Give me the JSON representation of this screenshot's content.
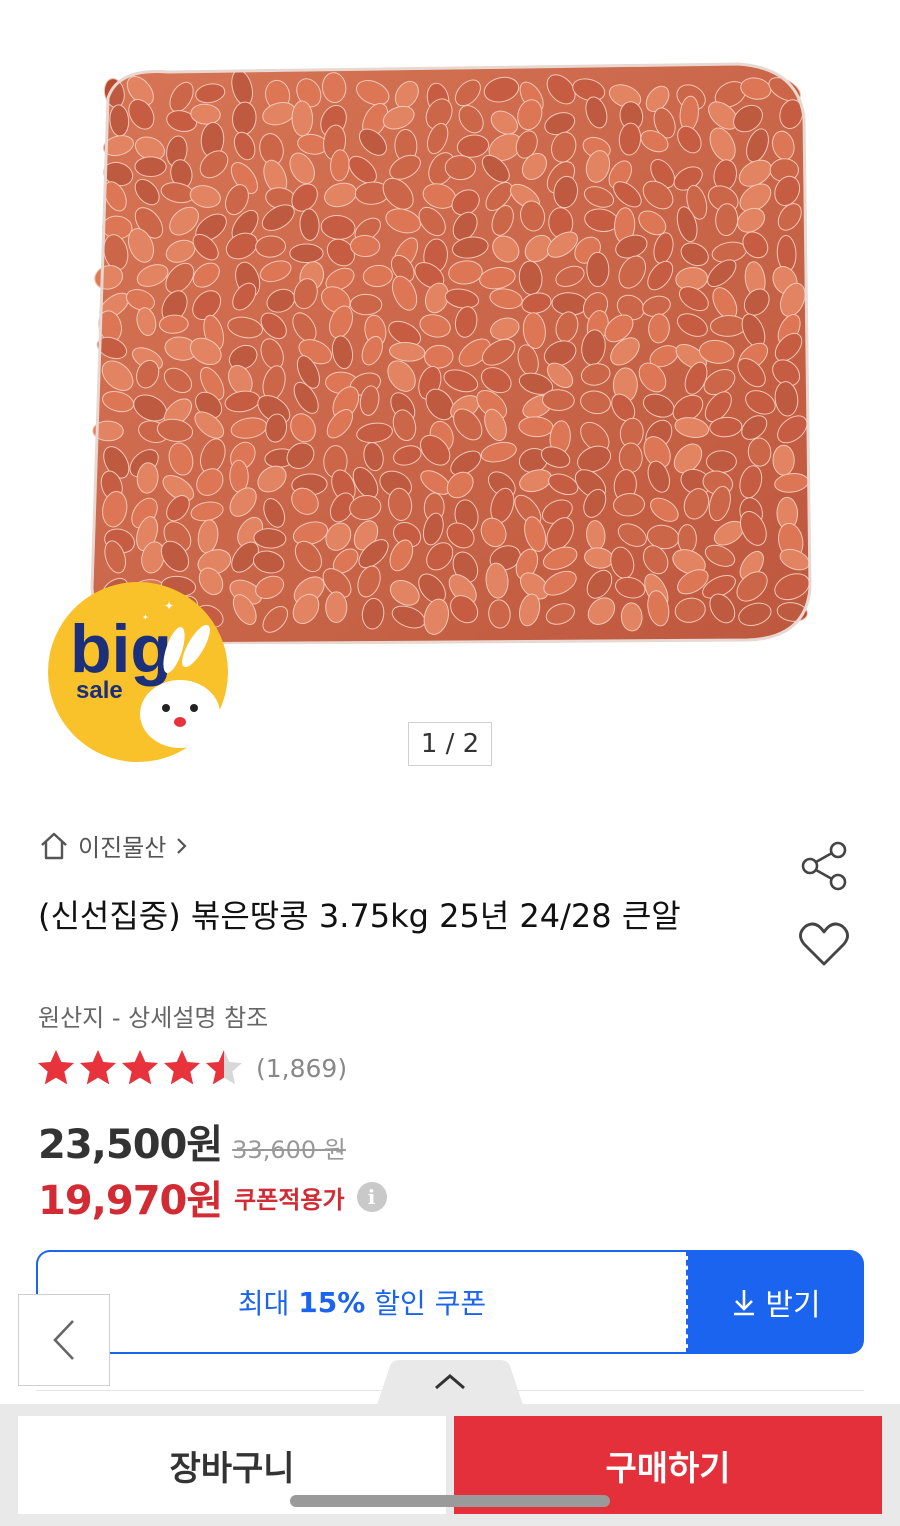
{
  "gallery": {
    "pager": "1 / 2",
    "badge": {
      "big": "big",
      "sale": "sale"
    }
  },
  "product": {
    "seller": "이진물산",
    "title": "(신선집중) 볶은땅콩 3.75kg 25년 24/28 큰알",
    "origin": "원산지 - 상세설명 참조",
    "rating": 4.5,
    "review_count": "(1,869)",
    "price": "23,500원",
    "original_price": "33,600 원",
    "coupon_price": "19,970원",
    "coupon_label": "쿠폰적용가",
    "info_icon": "i"
  },
  "coupon": {
    "prefix": "최대",
    "percent": "15%",
    "suffix": "할인 쿠폰",
    "download_label": "받기"
  },
  "bottom_bar": {
    "cart_label": "장바구니",
    "buy_label": "구매하기"
  },
  "colors": {
    "accent_blue": "#1a64f0",
    "sale_red": "#d22b34",
    "buy_red": "#e3303a",
    "star_red": "#e8323c"
  },
  "icons": [
    "home-icon",
    "chevron-right-icon",
    "share-icon",
    "heart-icon",
    "info-icon",
    "download-icon",
    "chevron-left-icon",
    "chevron-up-icon"
  ]
}
